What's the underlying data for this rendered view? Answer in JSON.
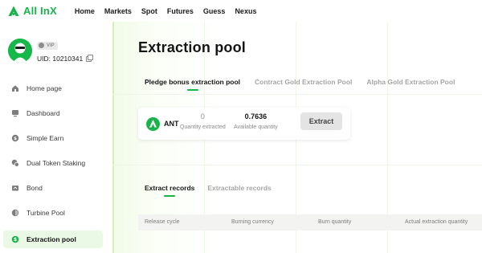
{
  "brand": {
    "name": "All InX",
    "color": "#19b34a"
  },
  "nav": {
    "links": [
      "Home",
      "Markets",
      "Spot",
      "Futures",
      "Guess",
      "Nexus"
    ]
  },
  "user": {
    "vip_label": "VIP",
    "uid": "UID: 10210341"
  },
  "sidebar": {
    "items": [
      {
        "label": "Home page",
        "icon": "home-icon"
      },
      {
        "label": "Dashboard",
        "icon": "dashboard-icon"
      },
      {
        "label": "Simple Earn",
        "icon": "coin-icon"
      },
      {
        "label": "Dual Token Staking",
        "icon": "dual-token-icon"
      },
      {
        "label": "Bond",
        "icon": "bond-icon"
      },
      {
        "label": "Turbine Pool",
        "icon": "turbine-icon"
      },
      {
        "label": "Extraction pool",
        "icon": "extraction-icon",
        "active": true
      }
    ]
  },
  "main": {
    "title": "Extraction pool",
    "tabs": [
      {
        "label": "Pledge bonus extraction pool",
        "active": true
      },
      {
        "label": "Contract Gold Extraction Pool"
      },
      {
        "label": "Alpha Gold Extraction Pool"
      }
    ],
    "card": {
      "token": "ANT",
      "extracted_value": "0",
      "extracted_label": "Quantity extracted",
      "available_value": "0.7636",
      "available_label": "Available quantity",
      "button": "Extract"
    },
    "records": {
      "tabs": [
        {
          "label": "Extract records",
          "active": true
        },
        {
          "label": "Extractable records"
        }
      ],
      "columns": [
        "Release cycle",
        "Burning currency",
        "Burn quantity",
        "Actual extraction quantity"
      ]
    }
  },
  "colors": {
    "accent": "#19b34a",
    "active_bg": "#eaf8e6"
  }
}
